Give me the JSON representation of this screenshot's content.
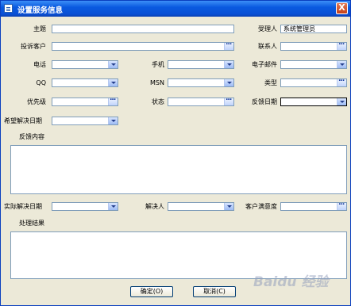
{
  "window": {
    "title": "设置服务信息",
    "close_label": "X"
  },
  "form": {
    "subject": {
      "label": "主题",
      "value": ""
    },
    "handler": {
      "label": "受理人",
      "value": "系统管理员"
    },
    "complaint_customer": {
      "label": "投诉客户",
      "value": ""
    },
    "contact": {
      "label": "联系人",
      "value": ""
    },
    "phone": {
      "label": "电话",
      "value": ""
    },
    "mobile": {
      "label": "手机",
      "value": ""
    },
    "email": {
      "label": "电子邮件",
      "value": ""
    },
    "qq": {
      "label": "QQ",
      "value": ""
    },
    "msn": {
      "label": "MSN",
      "value": ""
    },
    "type": {
      "label": "类型",
      "value": ""
    },
    "priority": {
      "label": "优先级",
      "value": ""
    },
    "status": {
      "label": "状态",
      "value": ""
    },
    "feedback_date": {
      "label": "反馈日期",
      "value": ""
    },
    "expected_resolve_date": {
      "label": "希望解决日期",
      "value": ""
    },
    "feedback_content": {
      "label": "反馈内容",
      "value": ""
    },
    "actual_resolve_date": {
      "label": "实际解决日期",
      "value": ""
    },
    "resolver": {
      "label": "解决人",
      "value": ""
    },
    "satisfaction": {
      "label": "客户满意度",
      "value": ""
    },
    "result": {
      "label": "处理结果",
      "value": ""
    }
  },
  "buttons": {
    "ok": "确定(O)",
    "cancel": "取消(C)"
  },
  "watermark": "Baidu 经验"
}
